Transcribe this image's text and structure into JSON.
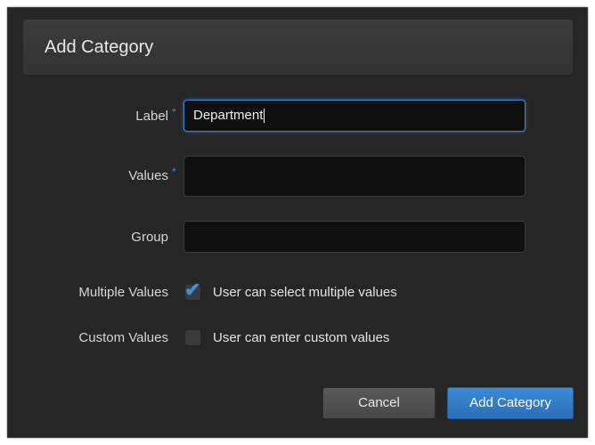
{
  "dialog": {
    "title": "Add Category"
  },
  "form": {
    "label": {
      "label": "Label",
      "required_mark": "*",
      "value": "Department"
    },
    "values": {
      "label": "Values",
      "required_mark": "*",
      "value": ""
    },
    "group": {
      "label": "Group",
      "value": ""
    },
    "multiple_values": {
      "label": "Multiple Values",
      "checkbox_text": "User can select multiple values",
      "checked": true
    },
    "custom_values": {
      "label": "Custom Values",
      "checkbox_text": "User can enter custom values",
      "checked": false
    }
  },
  "buttons": {
    "cancel": "Cancel",
    "add": "Add Category"
  },
  "colors": {
    "accent": "#3f89d3",
    "dialog_bg": "#262626",
    "input_bg": "#0f0f0f"
  },
  "icons": {
    "check": "checkmark-icon"
  }
}
